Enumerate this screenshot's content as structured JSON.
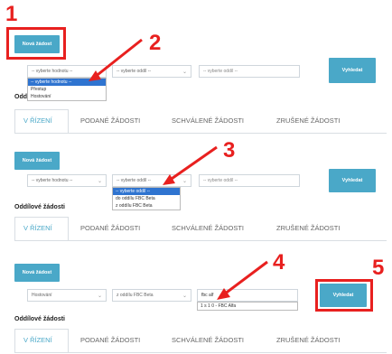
{
  "colors": {
    "accent": "#4aa8c8",
    "annotation": "#e8201f",
    "selected_option": "#2f74d0"
  },
  "steps": [
    "1",
    "2",
    "3",
    "4",
    "5"
  ],
  "new_request_label": "Nová žádost",
  "search_label": "Vyhledat",
  "section_title": "Oddílové žádosti",
  "section_title_partial": "Odd",
  "tabs": [
    "V ŘÍZENÍ",
    "PODANÉ ŽÁDOSTI",
    "SCHVÁLENÉ ŽÁDOSTI",
    "ZRUŠENÉ ŽÁDOSTI"
  ],
  "placeholder_select": "-- vyberte hodnotu --",
  "placeholder_unit": "-- vyberte oddíl --",
  "placeholder_text": "-- vyberte oddíl --",
  "type_options": [
    "-- vyberte hodnotu --",
    "Přestup",
    "Hostování"
  ],
  "unit_options": [
    "-- vyberte oddíl --",
    "do oddílu FBC Beta",
    "z oddílu FBC Beta"
  ],
  "filled": {
    "type": "Hostování",
    "unit": "z oddílu FBC Beta",
    "search_text": "fbc alf"
  },
  "suggestions": [
    "1 s 1 0 - FBC Alfa"
  ]
}
